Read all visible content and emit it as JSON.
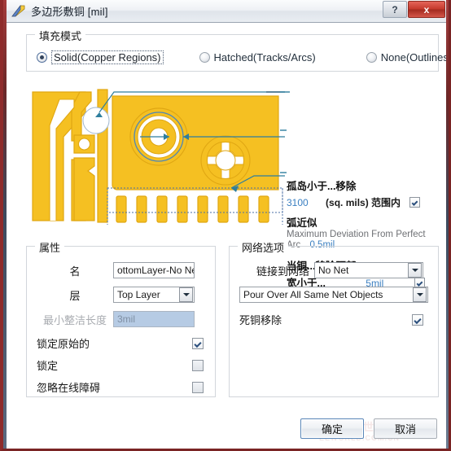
{
  "window": {
    "title": "多边形敷铜 [mil]",
    "icon": "polygon-pour-icon",
    "help_label": "?",
    "close_label": "x"
  },
  "fill_mode": {
    "group_title": "填充模式",
    "options": [
      {
        "label": "Solid(Copper Regions)",
        "selected": true
      },
      {
        "label": "Hatched(Tracks/Arcs)",
        "selected": false
      },
      {
        "label": "None(Outlines Only)",
        "selected": false
      }
    ]
  },
  "annotations": {
    "island": {
      "heading": "孤岛小于...移除",
      "value": "3100",
      "unit": "(sq. mils) 范围内",
      "checked": true
    },
    "arc": {
      "heading": "弧近似",
      "description_line1": "Maximum Deviation From Perfect",
      "description_line2": "Arc",
      "value": "0.5mil"
    },
    "neck": {
      "heading": "当铜...移除颈部",
      "label": "宽小于...",
      "value": "5mil",
      "checked": true
    }
  },
  "properties": {
    "group_title": "属性",
    "name_label": "名",
    "name_value": "ottomLayer-No Net",
    "layer_label": "层",
    "layer_value": "Top Layer",
    "min_prim_label": "最小整洁长度",
    "min_prim_value": "3mil",
    "lock_primitives_label": "锁定原始的",
    "lock_primitives_checked": true,
    "locked_label": "锁定",
    "locked_checked": false,
    "ignore_violations_label": "忽略在线障碍",
    "ignore_violations_checked": false
  },
  "net_options": {
    "group_title": "网络选项",
    "connect_label": "链接到网络",
    "connect_value": "No Net",
    "pour_value": "Pour Over All Same Net Objects",
    "remove_dead_label": "死铜移除",
    "remove_dead_checked": true
  },
  "footer": {
    "ok_label": "确定",
    "cancel_label": "取消"
  },
  "watermark": {
    "line1": "电子工程世界",
    "line2": "EEWORLD.COM.CN"
  },
  "colors": {
    "copper": "#F5C022",
    "copper_stroke": "#E0A713",
    "accent_blue": "#3A7FC1",
    "arrow": "#2E7E9E",
    "selection_dotted": "#4A6FA5",
    "close_red": "#C5392C"
  }
}
